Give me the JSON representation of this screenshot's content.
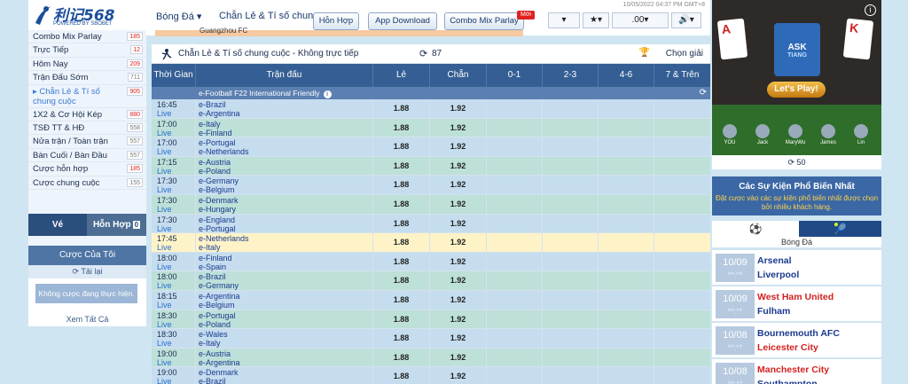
{
  "brand": {
    "name": "利记568",
    "sub": "POWERED BY SBOBET"
  },
  "top": {
    "nav": [
      "Bóng Đá ▾",
      "Chẵn Lẻ & Tí số chung c"
    ],
    "buttons": [
      "Hỗn Hợp",
      "App Download",
      "Combo Mix Parlay"
    ],
    "new_tag": "Mới",
    "datetime": "10/05/2022 04:37 PM GMT+8",
    "controls": [
      "▾",
      "★▾",
      ".00▾",
      "🔊▾"
    ],
    "strip_text": "Guangzhou FC"
  },
  "sidebar": {
    "items": [
      {
        "label": "Combo Mix Parlay",
        "count": "185",
        "red": true
      },
      {
        "label": "Trực Tiếp",
        "count": "12",
        "red": true
      },
      {
        "label": "Hôm Nay",
        "count": "209",
        "red": true
      },
      {
        "label": "Trận Đấu Sớm",
        "count": "711",
        "red": false
      },
      {
        "label": "▸ Chẵn Lẻ & Tí số chung cuộc",
        "count": "905",
        "red": true
      },
      {
        "label": "1X2 & Cơ Hội Kép",
        "count": "880",
        "red": true
      },
      {
        "label": "TSĐ TT & HĐ",
        "count": "558",
        "red": false
      },
      {
        "label": "Nửa trận / Toàn trận",
        "count": "557",
        "red": false
      },
      {
        "label": "Bàn Cuối / Bàn Đầu",
        "count": "557",
        "red": false
      },
      {
        "label": "Cược hỗn hợp",
        "count": "185",
        "red": true
      },
      {
        "label": "Cược chung cuộc",
        "count": "155",
        "red": false
      }
    ],
    "tab_ve": "Vé",
    "tab_hon_hop": "Hỗn Hợp",
    "tab_hon_hop_count": "0",
    "my_bets_title": "Cược Của Tôi",
    "reload": "⟳ Tải lại",
    "no_bets": "Không cược đang thực hiện.",
    "view_all": "Xem Tất Cả"
  },
  "panel": {
    "title": "Chẵn Lẻ & Tí số chung cuộc - Không trực tiếp",
    "count": "87",
    "select_league": "Chọn giải",
    "columns": [
      "Thời Gian",
      "Trận đấu",
      "Lẻ",
      "Chẵn",
      "0-1",
      "2-3",
      "4-6",
      "7 & Trên"
    ],
    "league": "e-Football F22 International Friendly",
    "rows": [
      {
        "time": "16:45",
        "status": "Live",
        "home": "e-Brazil",
        "away": "e-Argentina",
        "odd": "1.88",
        "even": "1.92"
      },
      {
        "time": "17:00",
        "status": "Live",
        "home": "e-Italy",
        "away": "e-Finland",
        "odd": "1.88",
        "even": "1.92"
      },
      {
        "time": "17:00",
        "status": "Live",
        "home": "e-Portugal",
        "away": "e-Netherlands",
        "odd": "1.88",
        "even": "1.92"
      },
      {
        "time": "17:15",
        "status": "Live",
        "home": "e-Austria",
        "away": "e-Poland",
        "odd": "1.88",
        "even": "1.92"
      },
      {
        "time": "17:30",
        "status": "Live",
        "home": "e-Germany",
        "away": "e-Belgium",
        "odd": "1.88",
        "even": "1.92"
      },
      {
        "time": "17:30",
        "status": "Live",
        "home": "e-Denmark",
        "away": "e-Hungary",
        "odd": "1.88",
        "even": "1.92"
      },
      {
        "time": "17:30",
        "status": "Live",
        "home": "e-England",
        "away": "e-Portugal",
        "odd": "1.88",
        "even": "1.92"
      },
      {
        "time": "17:45",
        "status": "Live",
        "home": "e-Netherlands",
        "away": "e-Italy",
        "odd": "1.88",
        "even": "1.92"
      },
      {
        "time": "18:00",
        "status": "Live",
        "home": "e-Finland",
        "away": "e-Spain",
        "odd": "1.88",
        "even": "1.92"
      },
      {
        "time": "18:00",
        "status": "Live",
        "home": "e-Brazil",
        "away": "e-Germany",
        "odd": "1.88",
        "even": "1.92"
      },
      {
        "time": "18:15",
        "status": "Live",
        "home": "e-Argentina",
        "away": "e-Belgium",
        "odd": "1.88",
        "even": "1.92"
      },
      {
        "time": "18:30",
        "status": "Live",
        "home": "e-Portugal",
        "away": "e-Poland",
        "odd": "1.88",
        "even": "1.92"
      },
      {
        "time": "18:30",
        "status": "Live",
        "home": "e-Wales",
        "away": "e-Italy",
        "odd": "1.88",
        "even": "1.92"
      },
      {
        "time": "19:00",
        "status": "Live",
        "home": "e-Austria",
        "away": "e-Argentina",
        "odd": "1.88",
        "even": "1.92"
      },
      {
        "time": "19:00",
        "status": "Live",
        "home": "e-Denmark",
        "away": "e-Brazil",
        "odd": "1.88",
        "even": "1.92"
      }
    ]
  },
  "right": {
    "promo_button": "Let's Play!",
    "promo_banner": "ASK",
    "promo_banner_sub": "TIANG",
    "card_left": "A",
    "card_right": "K",
    "players": [
      "YOU",
      "Jack",
      "MaryWu",
      "James",
      "Lin"
    ],
    "promo_count": "⟳ 50",
    "popular_title": "Các Sự Kiện Phổ Biến Nhất",
    "popular_sub": "Đặt cược vào các sự kiện phổ biến nhất được chọn bởi nhiều khách hàng.",
    "sport_label": "Bóng Đá",
    "events": [
      {
        "date": "10/09",
        "dots": "**:**",
        "home": "Arsenal",
        "away": "Liverpool",
        "home_red": false,
        "away_red": false
      },
      {
        "date": "10/09",
        "dots": "**:**",
        "home": "West Ham United",
        "away": "Fulham",
        "home_red": true,
        "away_red": false
      },
      {
        "date": "10/08",
        "dots": "**:**",
        "home": "Bournemouth AFC",
        "away": "Leicester City",
        "home_red": false,
        "away_red": true
      },
      {
        "date": "10/08",
        "dots": "**:**",
        "home": "Manchester City",
        "away": "Southampton",
        "home_red": true,
        "away_red": false
      }
    ]
  },
  "colors": {
    "header": "#355f94",
    "league": "#5b7fb0",
    "row_a": "#c5ddee",
    "row_b": "#bde0d8",
    "highlight": "#fdf3c7"
  }
}
